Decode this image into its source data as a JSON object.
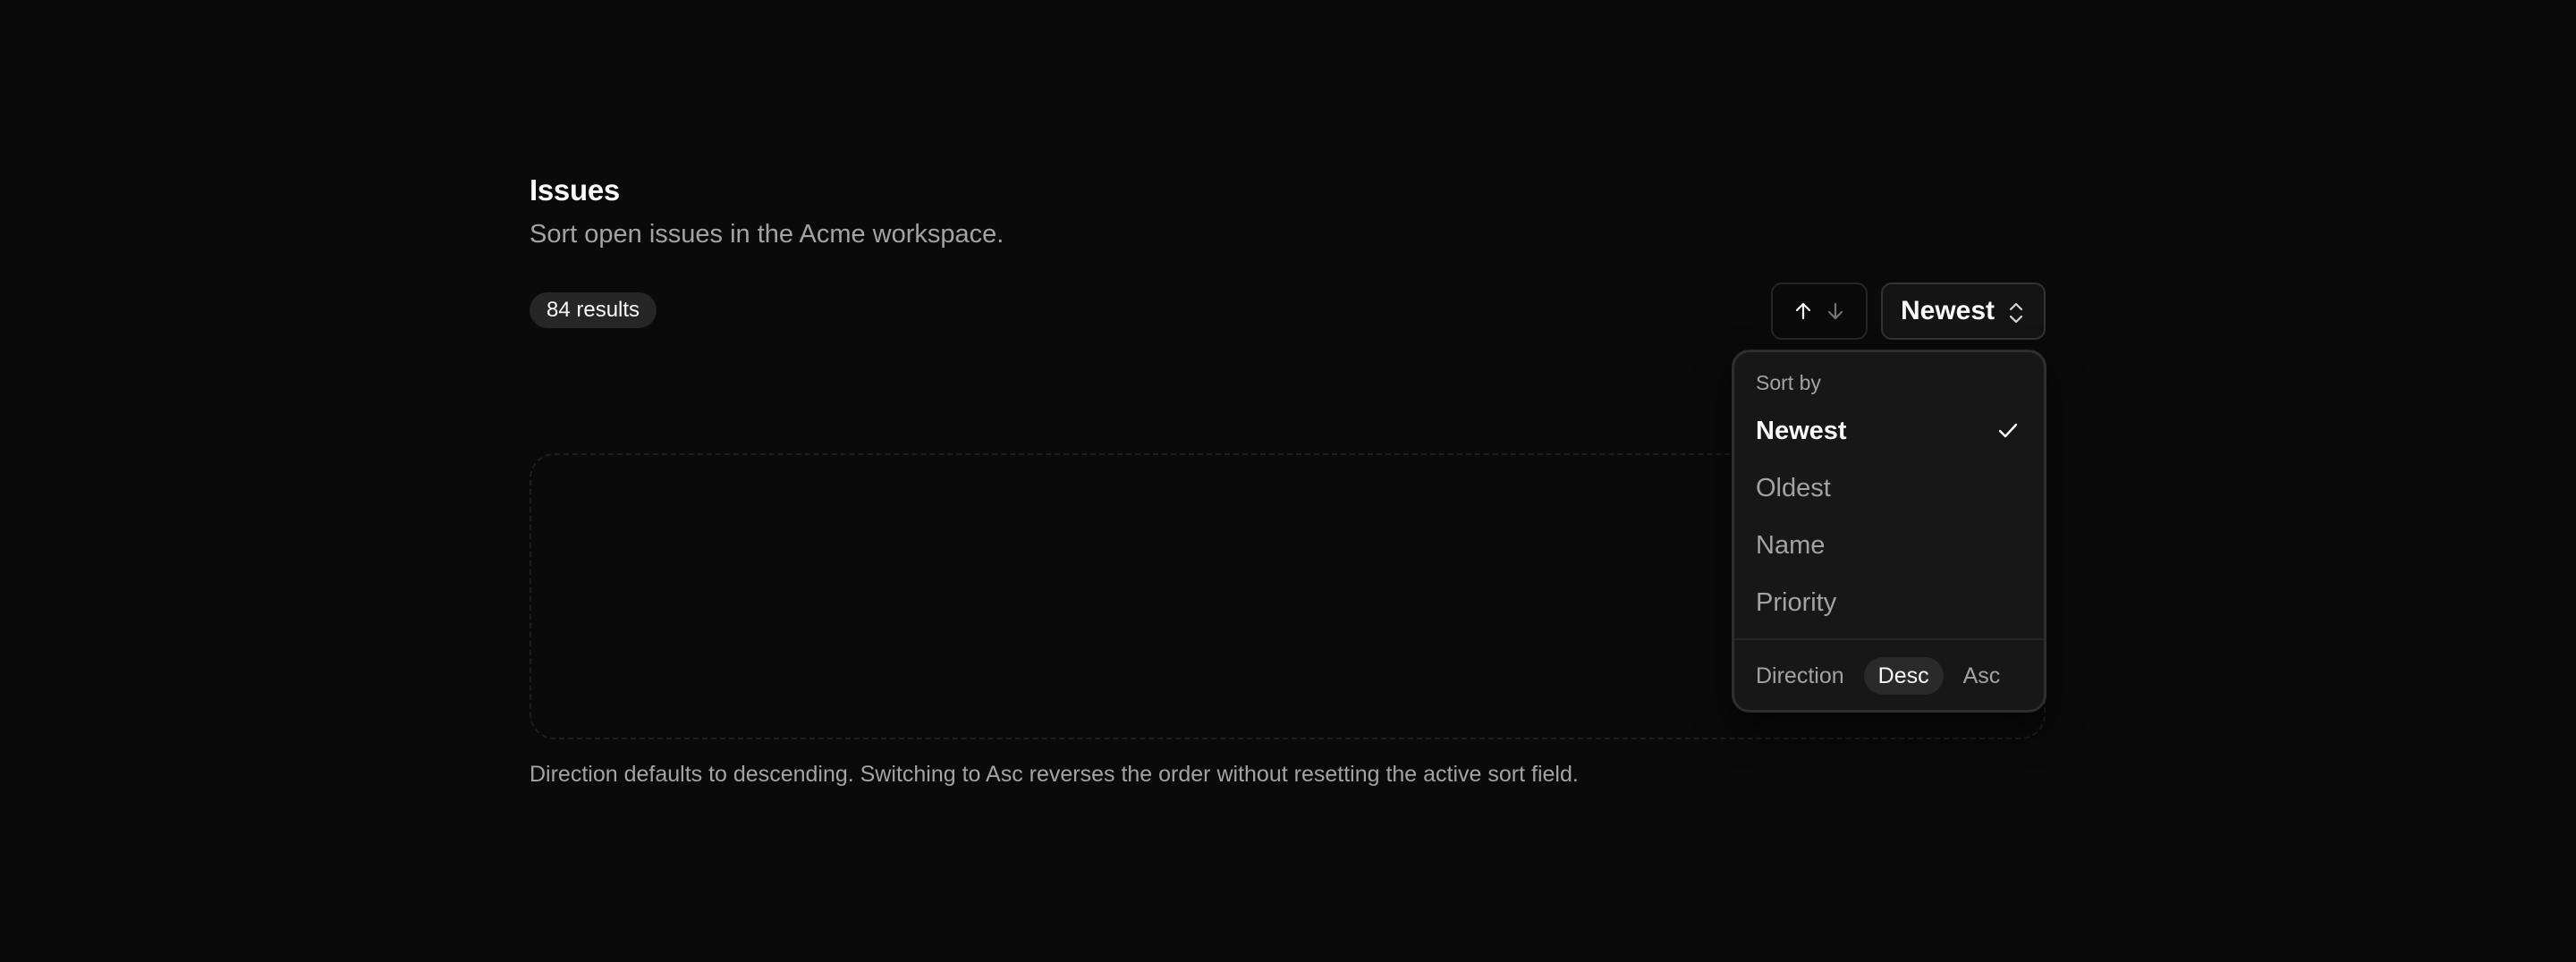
{
  "header": {
    "title": "Issues",
    "subtitle": "Sort open issues in the Acme workspace."
  },
  "results": {
    "count_label": "84 results"
  },
  "controls": {
    "direction_toggle": {
      "icons": [
        "arrow-up-icon",
        "arrow-down-icon"
      ],
      "active": "up"
    },
    "sort_trigger": {
      "label": "Newest",
      "icon": "chevrons-up-down-icon"
    }
  },
  "menu": {
    "label": "Sort by",
    "items": [
      {
        "label": "Newest",
        "selected": true
      },
      {
        "label": "Oldest",
        "selected": false
      },
      {
        "label": "Name",
        "selected": false
      },
      {
        "label": "Priority",
        "selected": false
      }
    ],
    "direction": {
      "label": "Direction",
      "options": [
        "Desc",
        "Asc"
      ],
      "selected": "Desc"
    }
  },
  "footer": {
    "hint": "Direction defaults to descending. Switching to Asc reverses the order without resetting the active sort field."
  },
  "colors": {
    "background": "#0a0a0a",
    "surface": "#171717",
    "text": "#fafafa",
    "muted": "#a3a3a3",
    "border": "#262626"
  }
}
